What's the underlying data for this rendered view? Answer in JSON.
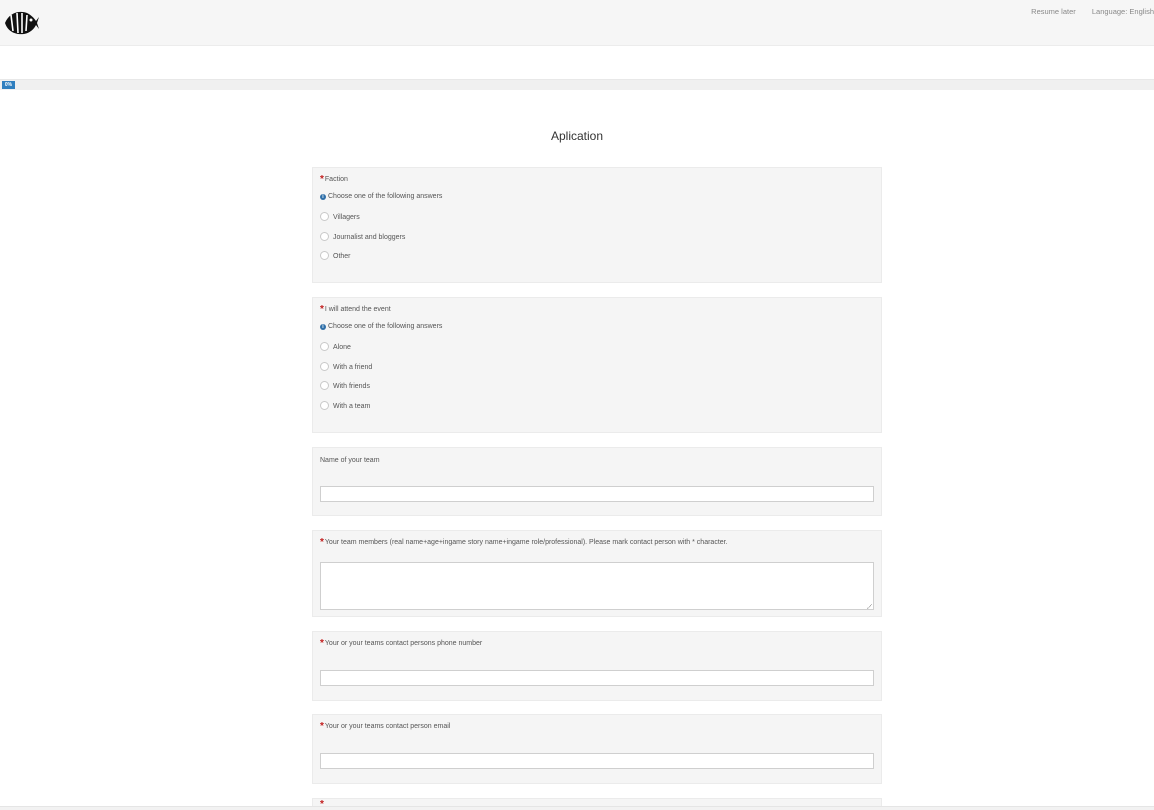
{
  "header": {
    "logo_icon": "fish-logo-icon",
    "resume_later": "Resume later",
    "language": "Language: English"
  },
  "progress": {
    "value_percent": 0,
    "label": "0%"
  },
  "page_title": "Aplication",
  "questions": [
    {
      "label": "Faction",
      "required": true,
      "hint": "Choose one of the following answers",
      "options": [
        "Villagers",
        "Journalist and bloggers",
        "Other"
      ]
    },
    {
      "label": "I will attend the event",
      "required": true,
      "hint": "Choose one of the following answers",
      "options": [
        "Alone",
        "With a friend",
        "With friends",
        "With a team"
      ]
    },
    {
      "label": "Name of your team",
      "required": false,
      "value": ""
    },
    {
      "label": "Your team members (real name+age+ingame story name+ingame role/professional). Please mark contact person with * character.",
      "required": true,
      "value": ""
    },
    {
      "label": "Your or your teams contact persons phone number",
      "required": true,
      "value": ""
    },
    {
      "label": "Your or your teams contact person email",
      "required": true,
      "value": ""
    }
  ],
  "required_marker": "*",
  "info_icon": "info-circle-icon",
  "colors": {
    "accent": "#2f7fbf",
    "required": "#c21d1d",
    "card_bg": "#f5f5f5"
  }
}
